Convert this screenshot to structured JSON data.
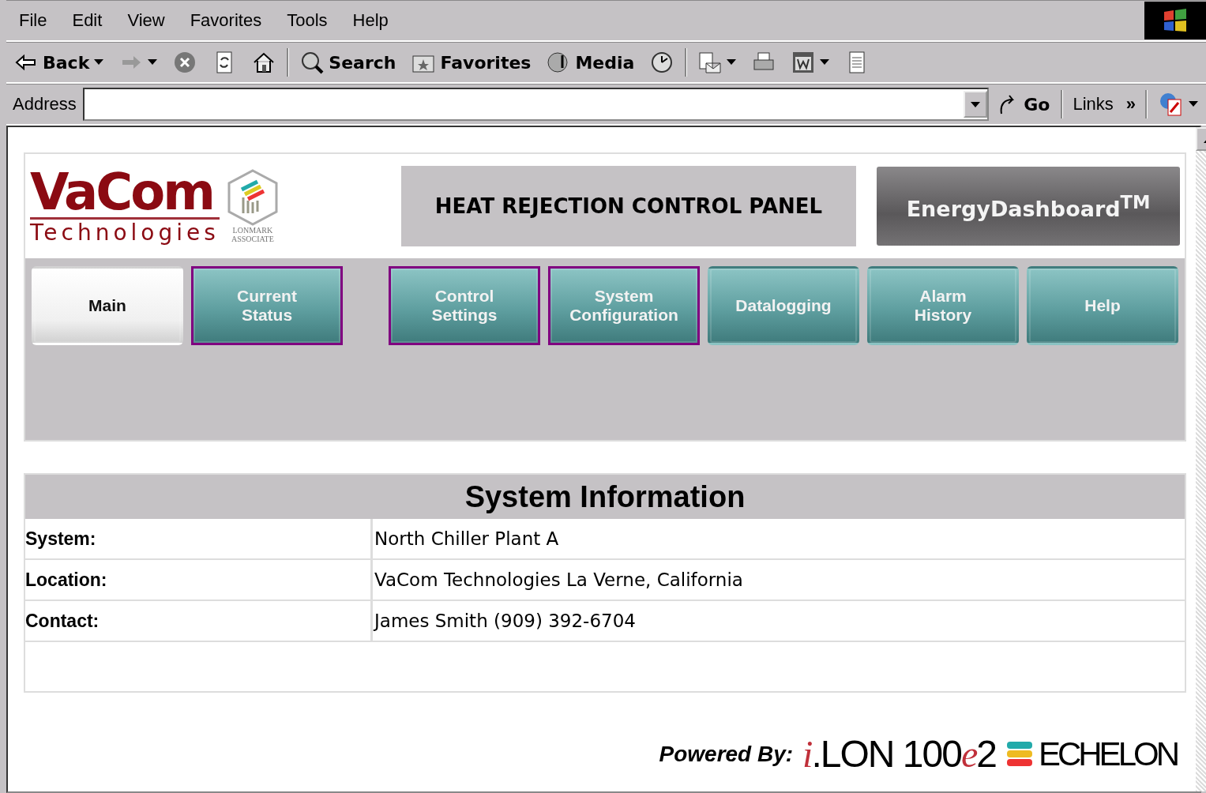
{
  "menu": [
    {
      "label": "File"
    },
    {
      "label": "Edit"
    },
    {
      "label": "View"
    },
    {
      "label": "Favorites"
    },
    {
      "label": "Tools"
    },
    {
      "label": "Help"
    }
  ],
  "toolbar": [
    {
      "kind": "back",
      "label": "Back"
    },
    {
      "kind": "forward"
    },
    {
      "kind": "stop"
    },
    {
      "kind": "refresh"
    },
    {
      "kind": "home"
    },
    {
      "kind": "sep"
    },
    {
      "kind": "search",
      "label": "Search"
    },
    {
      "kind": "favorites",
      "label": "Favorites"
    },
    {
      "kind": "media",
      "label": "Media"
    },
    {
      "kind": "history"
    },
    {
      "kind": "sep"
    },
    {
      "kind": "mail"
    },
    {
      "kind": "print"
    },
    {
      "kind": "word"
    },
    {
      "kind": "discuss"
    }
  ],
  "address": {
    "label": "Address",
    "go": "Go",
    "links": "Links",
    "chevron": "»"
  },
  "logo": {
    "name": "VaCom",
    "sub": "Technologies",
    "badge_top": "LONMARK",
    "badge_bottom": "ASSOCIATE"
  },
  "panel_title": "HEAT REJECTION CONTROL PANEL",
  "dashboard": {
    "label": "EnergyDashboard",
    "mark": "TM"
  },
  "nav": [
    {
      "label": "Main",
      "selected": true,
      "outlined": false
    },
    {
      "label": "Current\nStatus",
      "selected": false,
      "outlined": true
    },
    {
      "label": "Control\nSettings",
      "selected": false,
      "outlined": true
    },
    {
      "label": "System\nConfiguration",
      "selected": false,
      "outlined": true
    },
    {
      "label": "Datalogging",
      "selected": false,
      "outlined": false
    },
    {
      "label": "Alarm\nHistory",
      "selected": false,
      "outlined": false
    },
    {
      "label": "Help",
      "selected": false,
      "outlined": false
    }
  ],
  "system_info": {
    "title": "System Information",
    "rows": [
      {
        "label": "System:",
        "value": "North Chiller Plant A"
      },
      {
        "label": "Location:",
        "value": "VaCom Technologies La Verne, California"
      },
      {
        "label": "Contact:",
        "value": "James Smith (909) 392-6704"
      }
    ]
  },
  "footer": {
    "powered_by": "Powered By:",
    "ilon_i": "i",
    "ilon": ".LON",
    "model": "100",
    "model_e": "e",
    "model_2": "2",
    "echelon": "ECHELON"
  }
}
